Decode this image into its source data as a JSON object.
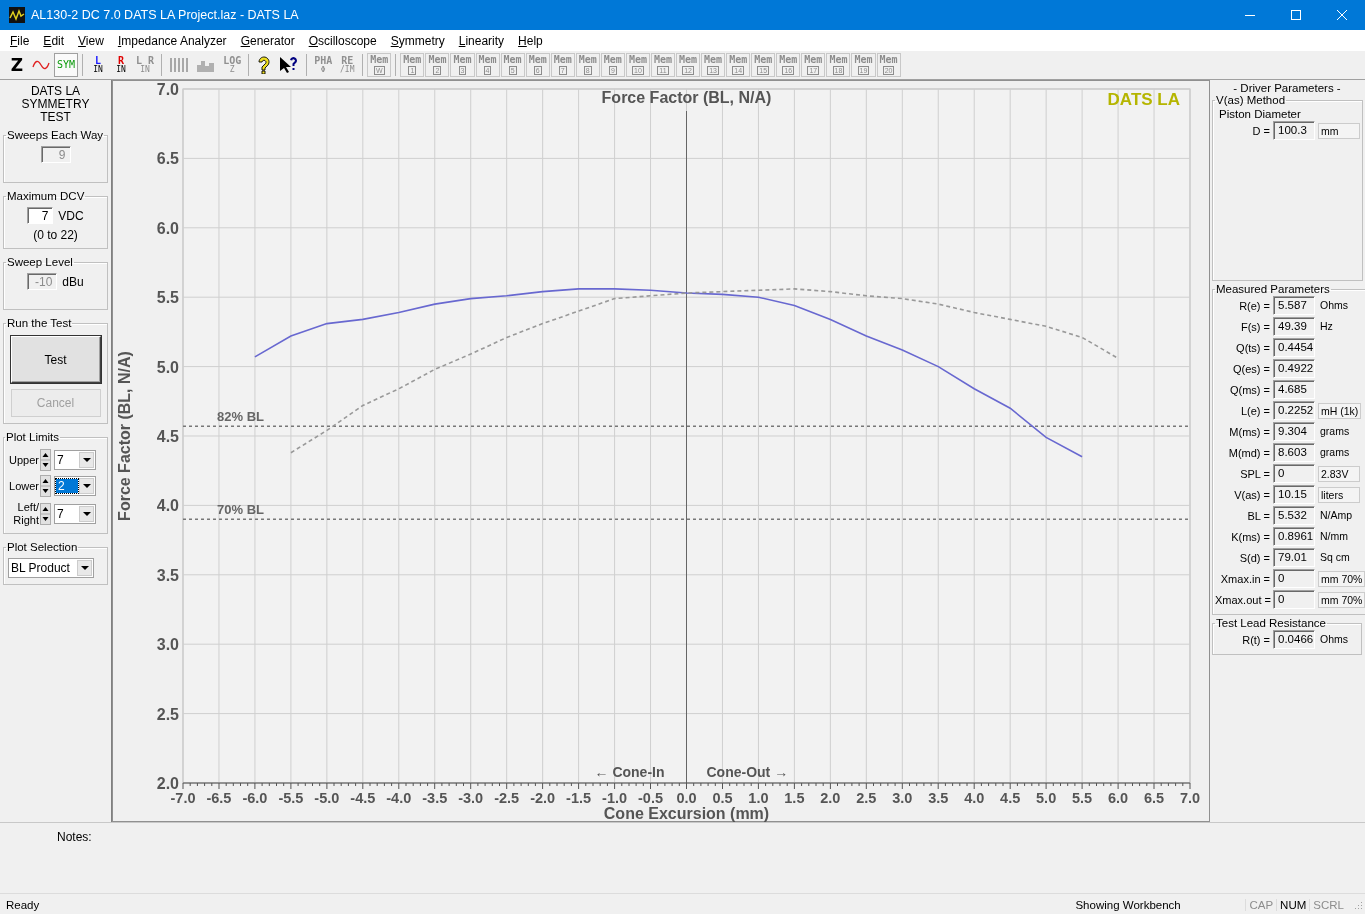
{
  "window": {
    "title": "AL130-2 DC 7.0 DATS LA Project.laz - DATS LA"
  },
  "menu": [
    {
      "label": "File"
    },
    {
      "label": "Edit"
    },
    {
      "label": "View"
    },
    {
      "label": "Impedance Analyzer"
    },
    {
      "label": "Generator"
    },
    {
      "label": "Oscilloscope"
    },
    {
      "label": "Symmetry"
    },
    {
      "label": "Linearity"
    },
    {
      "label": "Help"
    }
  ],
  "toolbar": [
    {
      "kind": "letter",
      "label": "Z",
      "disabled": false,
      "pressed": false
    },
    {
      "kind": "sine",
      "disabled": false,
      "pressed": false
    },
    {
      "kind": "text",
      "label": "SYM",
      "disabled": false,
      "pressed": true
    },
    {
      "kind": "sep"
    },
    {
      "kind": "stack",
      "label": "L",
      "sub": "IN",
      "color": "#1a1aff",
      "disabled": false,
      "pressed": false
    },
    {
      "kind": "stack",
      "label": "R",
      "sub": "IN",
      "color": "#e00000",
      "disabled": false,
      "pressed": false
    },
    {
      "kind": "stack",
      "label": "L R",
      "sub": "IN",
      "color": "#909090",
      "disabled": true,
      "pressed": false
    },
    {
      "kind": "sep"
    },
    {
      "kind": "bars",
      "disabled": true,
      "pressed": false
    },
    {
      "kind": "histogram",
      "disabled": true,
      "pressed": false
    },
    {
      "kind": "stack",
      "label": "LOG",
      "sub": "Z",
      "color": "#909090",
      "disabled": true,
      "pressed": false
    },
    {
      "kind": "sep"
    },
    {
      "kind": "help",
      "disabled": false,
      "pressed": false
    },
    {
      "kind": "context-help",
      "disabled": false,
      "pressed": false
    },
    {
      "kind": "sep"
    },
    {
      "kind": "stack",
      "label": "PHA",
      "sub": "Φ",
      "color": "#909090",
      "disabled": true,
      "pressed": false
    },
    {
      "kind": "stack",
      "label": "RE",
      "sub": "/IM",
      "color": "#909090",
      "disabled": true,
      "pressed": false
    },
    {
      "kind": "sep"
    },
    {
      "kind": "mem",
      "label": "Mem",
      "sub": "W",
      "disabled": true,
      "pressed": false
    },
    {
      "kind": "sep"
    },
    {
      "kind": "mem",
      "label": "Mem",
      "sub": "1",
      "disabled": true,
      "pressed": false
    },
    {
      "kind": "mem",
      "label": "Mem",
      "sub": "2",
      "disabled": true,
      "pressed": false
    },
    {
      "kind": "mem",
      "label": "Mem",
      "sub": "3",
      "disabled": true,
      "pressed": false
    },
    {
      "kind": "mem",
      "label": "Mem",
      "sub": "4",
      "disabled": true,
      "pressed": false
    },
    {
      "kind": "mem",
      "label": "Mem",
      "sub": "5",
      "disabled": true,
      "pressed": false
    },
    {
      "kind": "mem",
      "label": "Mem",
      "sub": "6",
      "disabled": true,
      "pressed": false
    },
    {
      "kind": "mem",
      "label": "Mem",
      "sub": "7",
      "disabled": true,
      "pressed": false
    },
    {
      "kind": "mem",
      "label": "Mem",
      "sub": "8",
      "disabled": true,
      "pressed": false
    },
    {
      "kind": "mem",
      "label": "Mem",
      "sub": "9",
      "disabled": true,
      "pressed": false
    },
    {
      "kind": "mem",
      "label": "Mem",
      "sub": "10",
      "disabled": true,
      "pressed": false
    },
    {
      "kind": "mem",
      "label": "Mem",
      "sub": "11",
      "disabled": true,
      "pressed": false
    },
    {
      "kind": "mem",
      "label": "Mem",
      "sub": "12",
      "disabled": true,
      "pressed": false
    },
    {
      "kind": "mem",
      "label": "Mem",
      "sub": "13",
      "disabled": true,
      "pressed": false
    },
    {
      "kind": "mem",
      "label": "Mem",
      "sub": "14",
      "disabled": true,
      "pressed": false
    },
    {
      "kind": "mem",
      "label": "Mem",
      "sub": "15",
      "disabled": true,
      "pressed": false
    },
    {
      "kind": "mem",
      "label": "Mem",
      "sub": "16",
      "disabled": true,
      "pressed": false
    },
    {
      "kind": "mem",
      "label": "Mem",
      "sub": "17",
      "disabled": true,
      "pressed": false
    },
    {
      "kind": "mem",
      "label": "Mem",
      "sub": "18",
      "disabled": true,
      "pressed": false
    },
    {
      "kind": "mem",
      "label": "Mem",
      "sub": "19",
      "disabled": true,
      "pressed": false
    },
    {
      "kind": "mem",
      "label": "Mem",
      "sub": "20",
      "disabled": true,
      "pressed": false
    }
  ],
  "left_panel": {
    "heading": "DATS LA\nSYMMETRY\nTEST",
    "groups": [
      {
        "kind": "field",
        "title": "Sweeps Each Way",
        "value": "9",
        "disabled": true
      },
      {
        "kind": "field",
        "title": "Maximum DCV",
        "value": "7",
        "unit": "VDC",
        "note": "(0 to 22)",
        "disabled": false
      },
      {
        "kind": "field",
        "title": "Sweep Level",
        "value": "-10",
        "unit": "dBu",
        "disabled": true
      },
      {
        "kind": "buttons",
        "title": "Run the Test",
        "buttons": [
          {
            "label": "Test",
            "disabled": false
          },
          {
            "label": "Cancel",
            "disabled": true
          }
        ]
      },
      {
        "kind": "limits",
        "title": "Plot Limits",
        "rows": [
          {
            "label": "Upper",
            "value": "7",
            "selected": false
          },
          {
            "label": "Lower",
            "value": "2",
            "selected": true
          },
          {
            "label": "Left/\nRight",
            "value": "7",
            "selected": false
          }
        ]
      },
      {
        "kind": "select",
        "title": "Plot Selection",
        "value": "BL Product"
      }
    ]
  },
  "chart": {
    "chart_data": {
      "type": "line",
      "title": "Force Factor (BL, N/A)",
      "xlabel": "Cone Excursion (mm)",
      "ylabel": "Force Factor (BL, N/A)",
      "x": [
        -6,
        -5.5,
        -5,
        -4.5,
        -4,
        -3.5,
        -3,
        -2.5,
        -2,
        -1.5,
        -1,
        -0.5,
        0,
        0.5,
        1,
        1.5,
        2,
        2.5,
        3,
        3.5,
        4,
        4.5,
        5,
        5.5,
        6
      ],
      "series": [
        {
          "color": "#6868d0",
          "line_style": "solid",
          "values": [
            5.07,
            5.22,
            5.31,
            5.34,
            5.39,
            5.45,
            5.49,
            5.51,
            5.54,
            5.56,
            5.56,
            5.55,
            5.53,
            5.52,
            5.5,
            5.44,
            5.34,
            5.22,
            5.12,
            5.0,
            4.84,
            4.7,
            4.49,
            4.35,
            null
          ]
        },
        {
          "color": "#999999",
          "line_style": "dashed",
          "values": [
            null,
            4.38,
            4.54,
            4.72,
            4.84,
            4.98,
            5.09,
            5.21,
            5.31,
            5.4,
            5.49,
            5.51,
            5.53,
            5.54,
            5.55,
            5.56,
            5.54,
            5.51,
            5.49,
            5.45,
            5.39,
            5.34,
            5.29,
            5.21,
            5.06
          ]
        }
      ],
      "grid": true,
      "xlim": [
        -7,
        7
      ],
      "ylim": [
        2,
        7
      ],
      "xticks": [
        {
          "value": -7,
          "label": "-7.0"
        },
        {
          "value": -6.5,
          "label": "-6.5"
        },
        {
          "value": -6,
          "label": "-6.0"
        },
        {
          "value": -5.5,
          "label": "-5.5"
        },
        {
          "value": -5,
          "label": "-5.0"
        },
        {
          "value": -4.5,
          "label": "-4.5"
        },
        {
          "value": -4,
          "label": "-4.0"
        },
        {
          "value": -3.5,
          "label": "-3.5"
        },
        {
          "value": -3,
          "label": "-3.0"
        },
        {
          "value": -2.5,
          "label": "-2.5"
        },
        {
          "value": -2,
          "label": "-2.0"
        },
        {
          "value": -1.5,
          "label": "-1.5"
        },
        {
          "value": -1,
          "label": "-1.0"
        },
        {
          "value": -0.5,
          "label": "-0.5"
        },
        {
          "value": 0,
          "label": "0.0"
        },
        {
          "value": 0.5,
          "label": "0.5"
        },
        {
          "value": 1,
          "label": "1.0"
        },
        {
          "value": 1.5,
          "label": "1.5"
        },
        {
          "value": 2,
          "label": "2.0"
        },
        {
          "value": 2.5,
          "label": "2.5"
        },
        {
          "value": 3,
          "label": "3.0"
        },
        {
          "value": 3.5,
          "label": "3.5"
        },
        {
          "value": 4,
          "label": "4.0"
        },
        {
          "value": 4.5,
          "label": "4.5"
        },
        {
          "value": 5,
          "label": "5.0"
        },
        {
          "value": 5.5,
          "label": "5.5"
        },
        {
          "value": 6,
          "label": "6.0"
        },
        {
          "value": 6.5,
          "label": "6.5"
        },
        {
          "value": 7,
          "label": "7.0"
        }
      ],
      "yticks": [
        {
          "value": 2,
          "label": "2.0"
        },
        {
          "value": 2.5,
          "label": "2.5"
        },
        {
          "value": 3,
          "label": "3.0"
        },
        {
          "value": 3.5,
          "label": "3.5"
        },
        {
          "value": 4,
          "label": "4.0"
        },
        {
          "value": 4.5,
          "label": "4.5"
        },
        {
          "value": 5,
          "label": "5.0"
        },
        {
          "value": 5.5,
          "label": "5.5"
        },
        {
          "value": 6,
          "label": "6.0"
        },
        {
          "value": 6.5,
          "label": "6.5"
        },
        {
          "value": 7,
          "label": "7.0"
        }
      ],
      "ref_lines": [
        {
          "axis": "y",
          "value": 4.57,
          "label": "82% BL"
        },
        {
          "axis": "y",
          "value": 3.9,
          "label": "70% BL"
        }
      ],
      "annotations": [
        {
          "text": "← Cone-In"
        },
        {
          "text": "Cone-Out →"
        },
        {
          "text": "DATS LA"
        }
      ]
    }
  },
  "right_panel": {
    "heading": "- Driver Parameters -",
    "method": {
      "title": "V(as) Method",
      "subtitle": "Piston Diameter",
      "row": {
        "label": "D =",
        "value": "100.3",
        "unit": "mm",
        "unit_boxed": true
      }
    },
    "measured": {
      "title": "Measured Parameters",
      "rows": [
        {
          "label": "R(e) =",
          "value": "5.587",
          "unit": "Ohms",
          "unit_boxed": false
        },
        {
          "label": "F(s) =",
          "value": "49.39",
          "unit": "Hz",
          "unit_boxed": false
        },
        {
          "label": "Q(ts) =",
          "value": "0.4454"
        },
        {
          "label": "Q(es) =",
          "value": "0.4922"
        },
        {
          "label": "Q(ms) =",
          "value": "4.685"
        },
        {
          "label": "L(e) =",
          "value": "0.2252",
          "unit": "mH (1k)",
          "unit_boxed": true
        },
        {
          "label": "M(ms) =",
          "value": "9.304",
          "unit": "grams",
          "unit_boxed": false
        },
        {
          "label": "M(md) =",
          "value": "8.603",
          "unit": "grams",
          "unit_boxed": false
        },
        {
          "label": "SPL =",
          "value": "0",
          "unit": "2.83V",
          "unit_boxed": true
        },
        {
          "label": "V(as) =",
          "value": "10.15",
          "unit": "liters",
          "unit_boxed": true
        },
        {
          "label": "BL =",
          "value": "5.532",
          "unit": "N/Amp",
          "unit_boxed": false
        },
        {
          "label": "K(ms) =",
          "value": "0.8961",
          "unit": "N/mm",
          "unit_boxed": false
        },
        {
          "label": "S(d) =",
          "value": "79.01",
          "unit": "Sq cm",
          "unit_boxed": false
        },
        {
          "label": "Xmax.in =",
          "value": "0",
          "unit": "mm 70%",
          "unit_boxed": true
        },
        {
          "label": "Xmax.out =",
          "value": "0",
          "unit": "mm 70%",
          "unit_boxed": true
        }
      ]
    },
    "lead": {
      "title": "Test Lead Resistance",
      "row": {
        "label": "R(t) =",
        "value": "0.0466",
        "unit": "Ohms",
        "unit_boxed": false
      }
    }
  },
  "notes": {
    "label": "Notes:"
  },
  "status_bar": {
    "message": "Ready",
    "info": "Showing Workbench",
    "indicators": [
      {
        "label": "CAP",
        "on": false
      },
      {
        "label": "NUM",
        "on": true
      },
      {
        "label": "SCRL",
        "on": false
      }
    ]
  }
}
